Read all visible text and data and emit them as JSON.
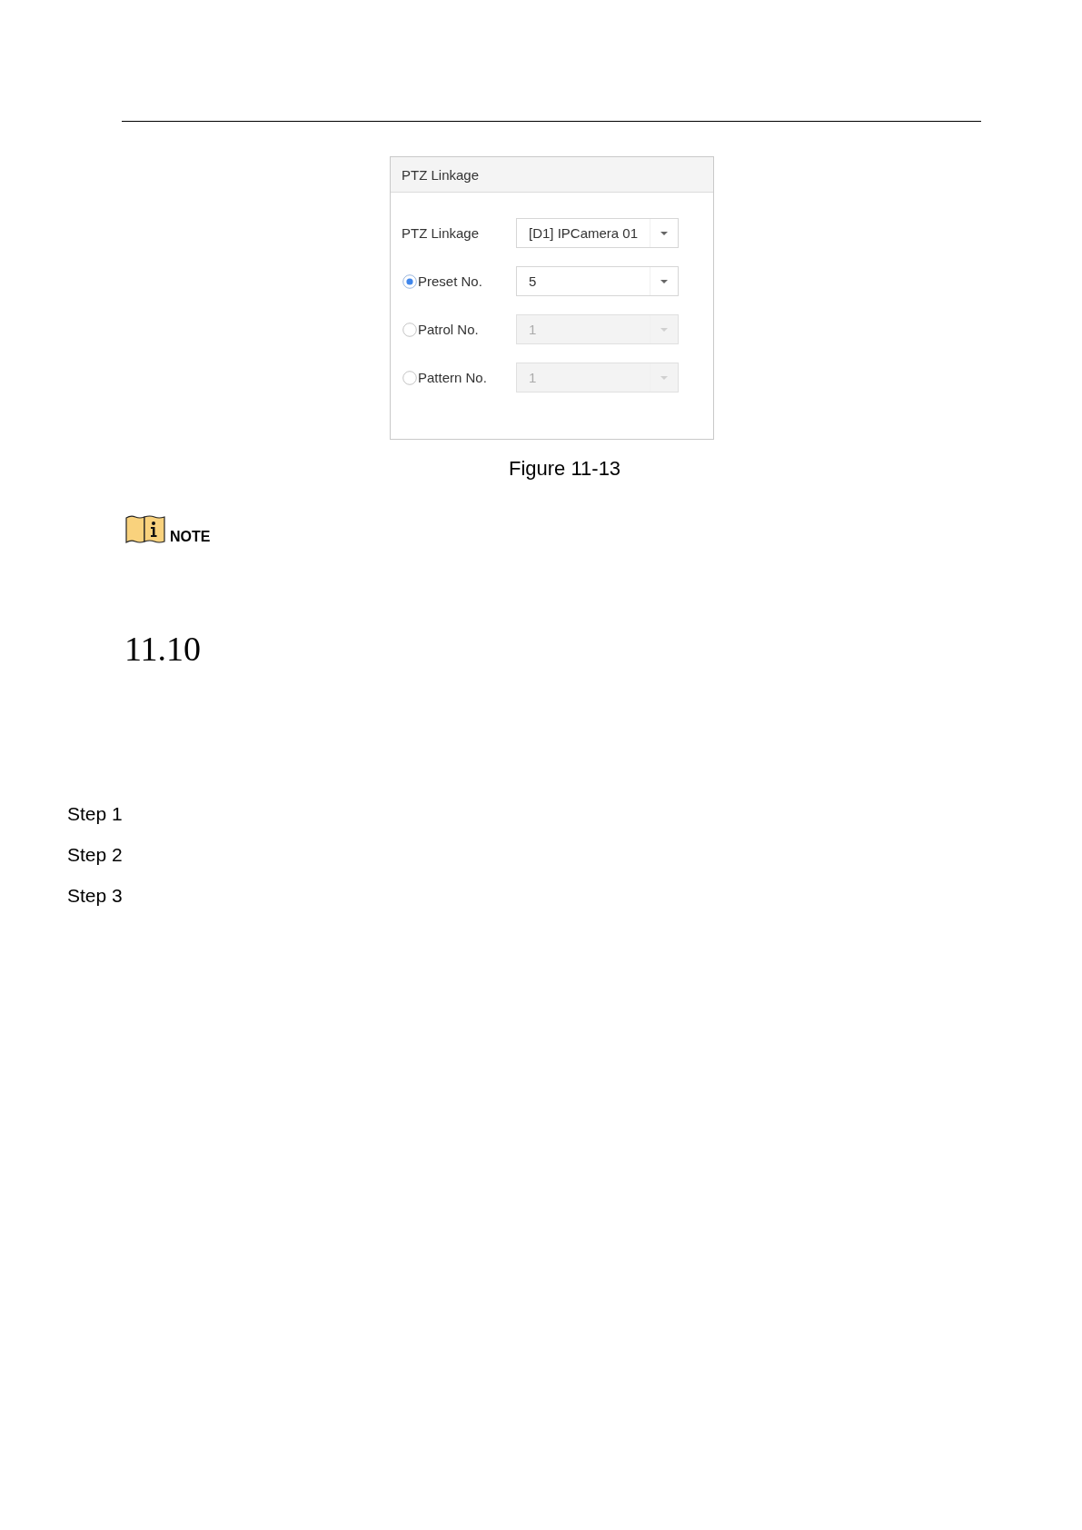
{
  "figure": {
    "dialog": {
      "title": "PTZ Linkage",
      "rows": [
        {
          "kind": "select",
          "label": "PTZ Linkage",
          "value": "[D1] IPCamera 01",
          "disabled": false
        },
        {
          "kind": "radio",
          "label": "Preset No.",
          "selected": true,
          "value": "5",
          "disabled": false
        },
        {
          "kind": "radio",
          "label": "Patrol No.",
          "selected": false,
          "value": "1",
          "disabled": true
        },
        {
          "kind": "radio",
          "label": "Pattern No.",
          "selected": false,
          "value": "1",
          "disabled": true
        }
      ]
    },
    "caption": "Figure 11-13"
  },
  "note": {
    "label": "NOTE"
  },
  "section": {
    "number": "11.10"
  },
  "steps": [
    {
      "label": "Step 1"
    },
    {
      "label": "Step 2"
    },
    {
      "label": "Step 3"
    }
  ]
}
